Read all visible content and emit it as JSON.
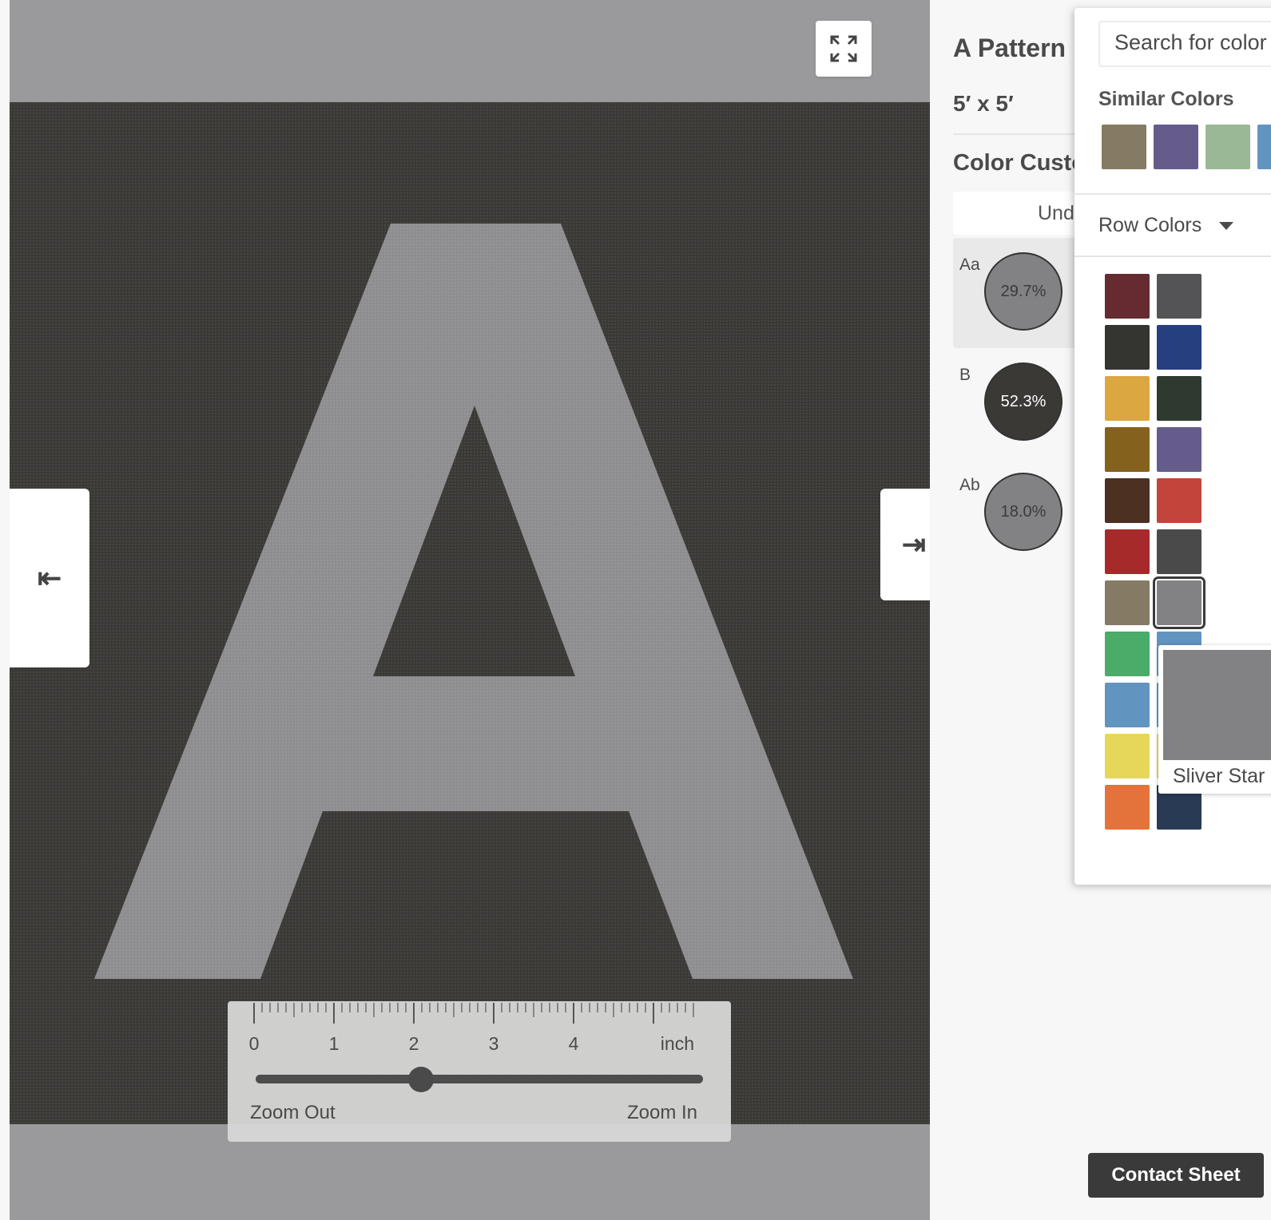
{
  "product": {
    "title": "A Pattern",
    "size": "5′ x 5′"
  },
  "customize": {
    "section_title": "Color Custo",
    "undo_label": "Undo",
    "layers": [
      {
        "label": "Aa",
        "percent": "29.7%",
        "color": "#828285",
        "text_color": "#3a3a3a"
      },
      {
        "label": "B",
        "percent": "52.3%",
        "color": "#3a3936",
        "text_color": "#ffffff"
      },
      {
        "label": "Ab",
        "percent": "18.0%",
        "color": "#828285",
        "text_color": "#3a3a3a"
      }
    ]
  },
  "preview": {
    "background_color": "#9a9a9c",
    "field_color": "#3a3936",
    "letter_color": "#8e8e90",
    "fullscreen_icon": "expand-icon",
    "collapse_left_icon": "collapse-left-icon",
    "collapse_left_glyph": "⇤",
    "expand_right_icon": "expand-right-icon",
    "expand_right_glyph": "⇥"
  },
  "zoom": {
    "ruler_numbers": [
      "0",
      "1",
      "2",
      "3",
      "4"
    ],
    "unit": "inch",
    "zoom_level": 0.37,
    "zoom_out_label": "Zoom Out",
    "zoom_in_label": "Zoom In"
  },
  "picker": {
    "search_placeholder": "Search for color",
    "similar_heading": "Similar Colors",
    "similar_colors": [
      "#857a64",
      "#655c8c",
      "#9ab896",
      "#6294c0"
    ],
    "row_colors_label": "Row Colors",
    "grid_colors": [
      "#652b30",
      "#545456",
      "#343431",
      "#263f7e",
      "#dba741",
      "#2e3a30",
      "#84621d",
      "#655c8c",
      "#4c3022",
      "#c3443a",
      "#a62a2a",
      "#4a4a4a",
      "#857a64",
      "#828285",
      "#4bab68",
      "#6294c0",
      "#6294c0",
      "#6294c0",
      "#e6d75a",
      "#e6d75a",
      "#e3733a",
      "#293a55"
    ],
    "selected_index": 13,
    "tooltip_label": "Sliver Star",
    "tooltip_color": "#828285"
  },
  "footer": {
    "contact_sheet_label": "Contact Sheet"
  }
}
